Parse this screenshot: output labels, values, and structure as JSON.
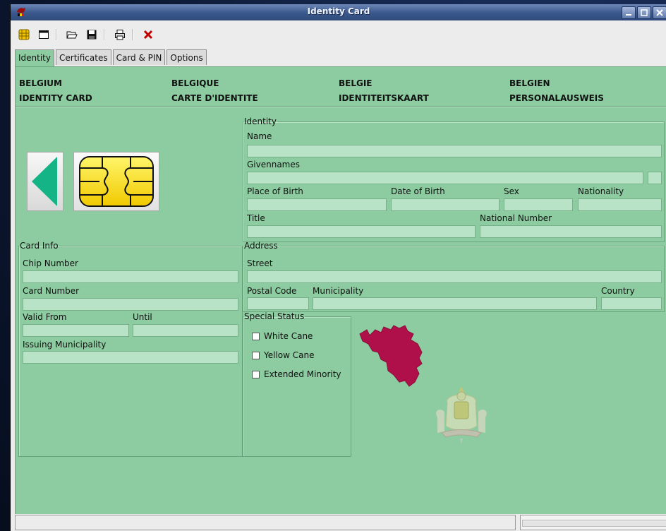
{
  "window": {
    "title": "Identity Card"
  },
  "toolbar": {
    "buttons": [
      {
        "name": "eid-card-icon"
      },
      {
        "name": "window-icon"
      },
      {
        "name": "open-folder-icon"
      },
      {
        "name": "save-icon"
      },
      {
        "name": "print-icon"
      },
      {
        "name": "close-x-icon"
      }
    ]
  },
  "tabs": [
    "Identity",
    "Certificates",
    "Card & PIN",
    "Options"
  ],
  "header": {
    "col1": {
      "line1": "BELGIUM",
      "line2": "IDENTITY CARD"
    },
    "col2": {
      "line1": "BELGIQUE",
      "line2": "CARTE D'IDENTITE"
    },
    "col3": {
      "line1": "BELGIE",
      "line2": "IDENTITEITSKAART"
    },
    "col4": {
      "line1": "BELGIEN",
      "line2": "PERSONALAUSWEIS"
    }
  },
  "identity": {
    "legend": "Identity",
    "name_label": "Name",
    "name_value": "",
    "givennames_label": "Givennames",
    "givennames_value": "",
    "initial_value": "",
    "place_of_birth_label": "Place of Birth",
    "place_of_birth_value": "",
    "date_of_birth_label": "Date of Birth",
    "date_of_birth_value": "",
    "sex_label": "Sex",
    "sex_value": "",
    "nationality_label": "Nationality",
    "nationality_value": "",
    "title_label": "Title",
    "title_value": "",
    "national_number_label": "National Number",
    "national_number_value": ""
  },
  "card_info": {
    "legend": "Card Info",
    "chip_number_label": "Chip Number",
    "chip_number_value": "",
    "card_number_label": "Card Number",
    "card_number_value": "",
    "valid_from_label": "Valid From",
    "valid_from_value": "",
    "until_label": "Until",
    "until_value": "",
    "issuing_municipality_label": "Issuing Municipality",
    "issuing_municipality_value": ""
  },
  "address": {
    "legend": "Address",
    "street_label": "Street",
    "street_value": "",
    "postal_code_label": "Postal Code",
    "postal_code_value": "",
    "municipality_label": "Municipality",
    "municipality_value": "",
    "country_label": "Country",
    "country_value": ""
  },
  "special_status": {
    "legend": "Special Status",
    "options": [
      {
        "label": "White Cane",
        "checked": false
      },
      {
        "label": "Yellow Cane",
        "checked": false
      },
      {
        "label": "Extended Minority",
        "checked": false
      }
    ]
  },
  "statusbar": {
    "message": "",
    "progress": 0
  },
  "colors": {
    "panel_bg": "#8ccca0",
    "field_bg": "#b9e3c6",
    "map_color": "#b0104a",
    "arrow_color": "#14b487",
    "chip_color": "#ffe400"
  }
}
